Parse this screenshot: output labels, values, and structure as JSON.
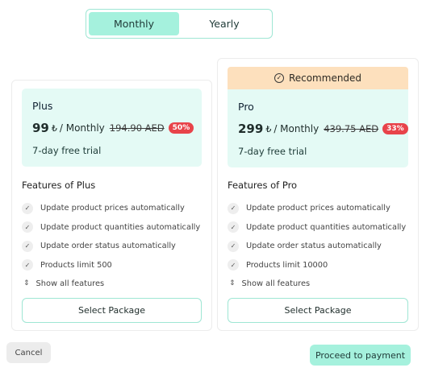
{
  "billing_toggle": {
    "monthly": "Monthly",
    "yearly": "Yearly",
    "active": "monthly"
  },
  "plans": [
    {
      "name": "Plus",
      "price": "99",
      "currency_symbol": "₺",
      "period": "/ Monthly",
      "original_price": "194.90 AED",
      "discount": "50%",
      "trial": "7-day free trial",
      "features_title": "Features of Plus",
      "features": [
        "Update product prices automatically",
        "Update product quantities automatically",
        "Update order status automatically",
        "Products limit 500"
      ],
      "show_all": "Show all features",
      "select_label": "Select Package"
    },
    {
      "name": "Pro",
      "recommended_label": "Recommended",
      "price": "299",
      "currency_symbol": "₺",
      "period": "/ Monthly",
      "original_price": "439.75 AED",
      "discount": "33%",
      "trial": "7-day free trial",
      "features_title": "Features of Pro",
      "features": [
        "Update product prices automatically",
        "Update product quantities automatically",
        "Update order status automatically",
        "Products limit 10000"
      ],
      "show_all": "Show all features",
      "select_label": "Select Package"
    }
  ],
  "footer": {
    "cancel_label": "Cancel",
    "proceed_label": "Proceed to payment"
  },
  "colors": {
    "accent": "#a5f1dd",
    "price_box": "#e4faf5",
    "recommended": "#fde0bd",
    "discount_badge": "#e8434a"
  },
  "icons": {
    "check": "check-icon",
    "recommended": "check-circle-icon",
    "show_all": "chevron-up-down-icon"
  }
}
